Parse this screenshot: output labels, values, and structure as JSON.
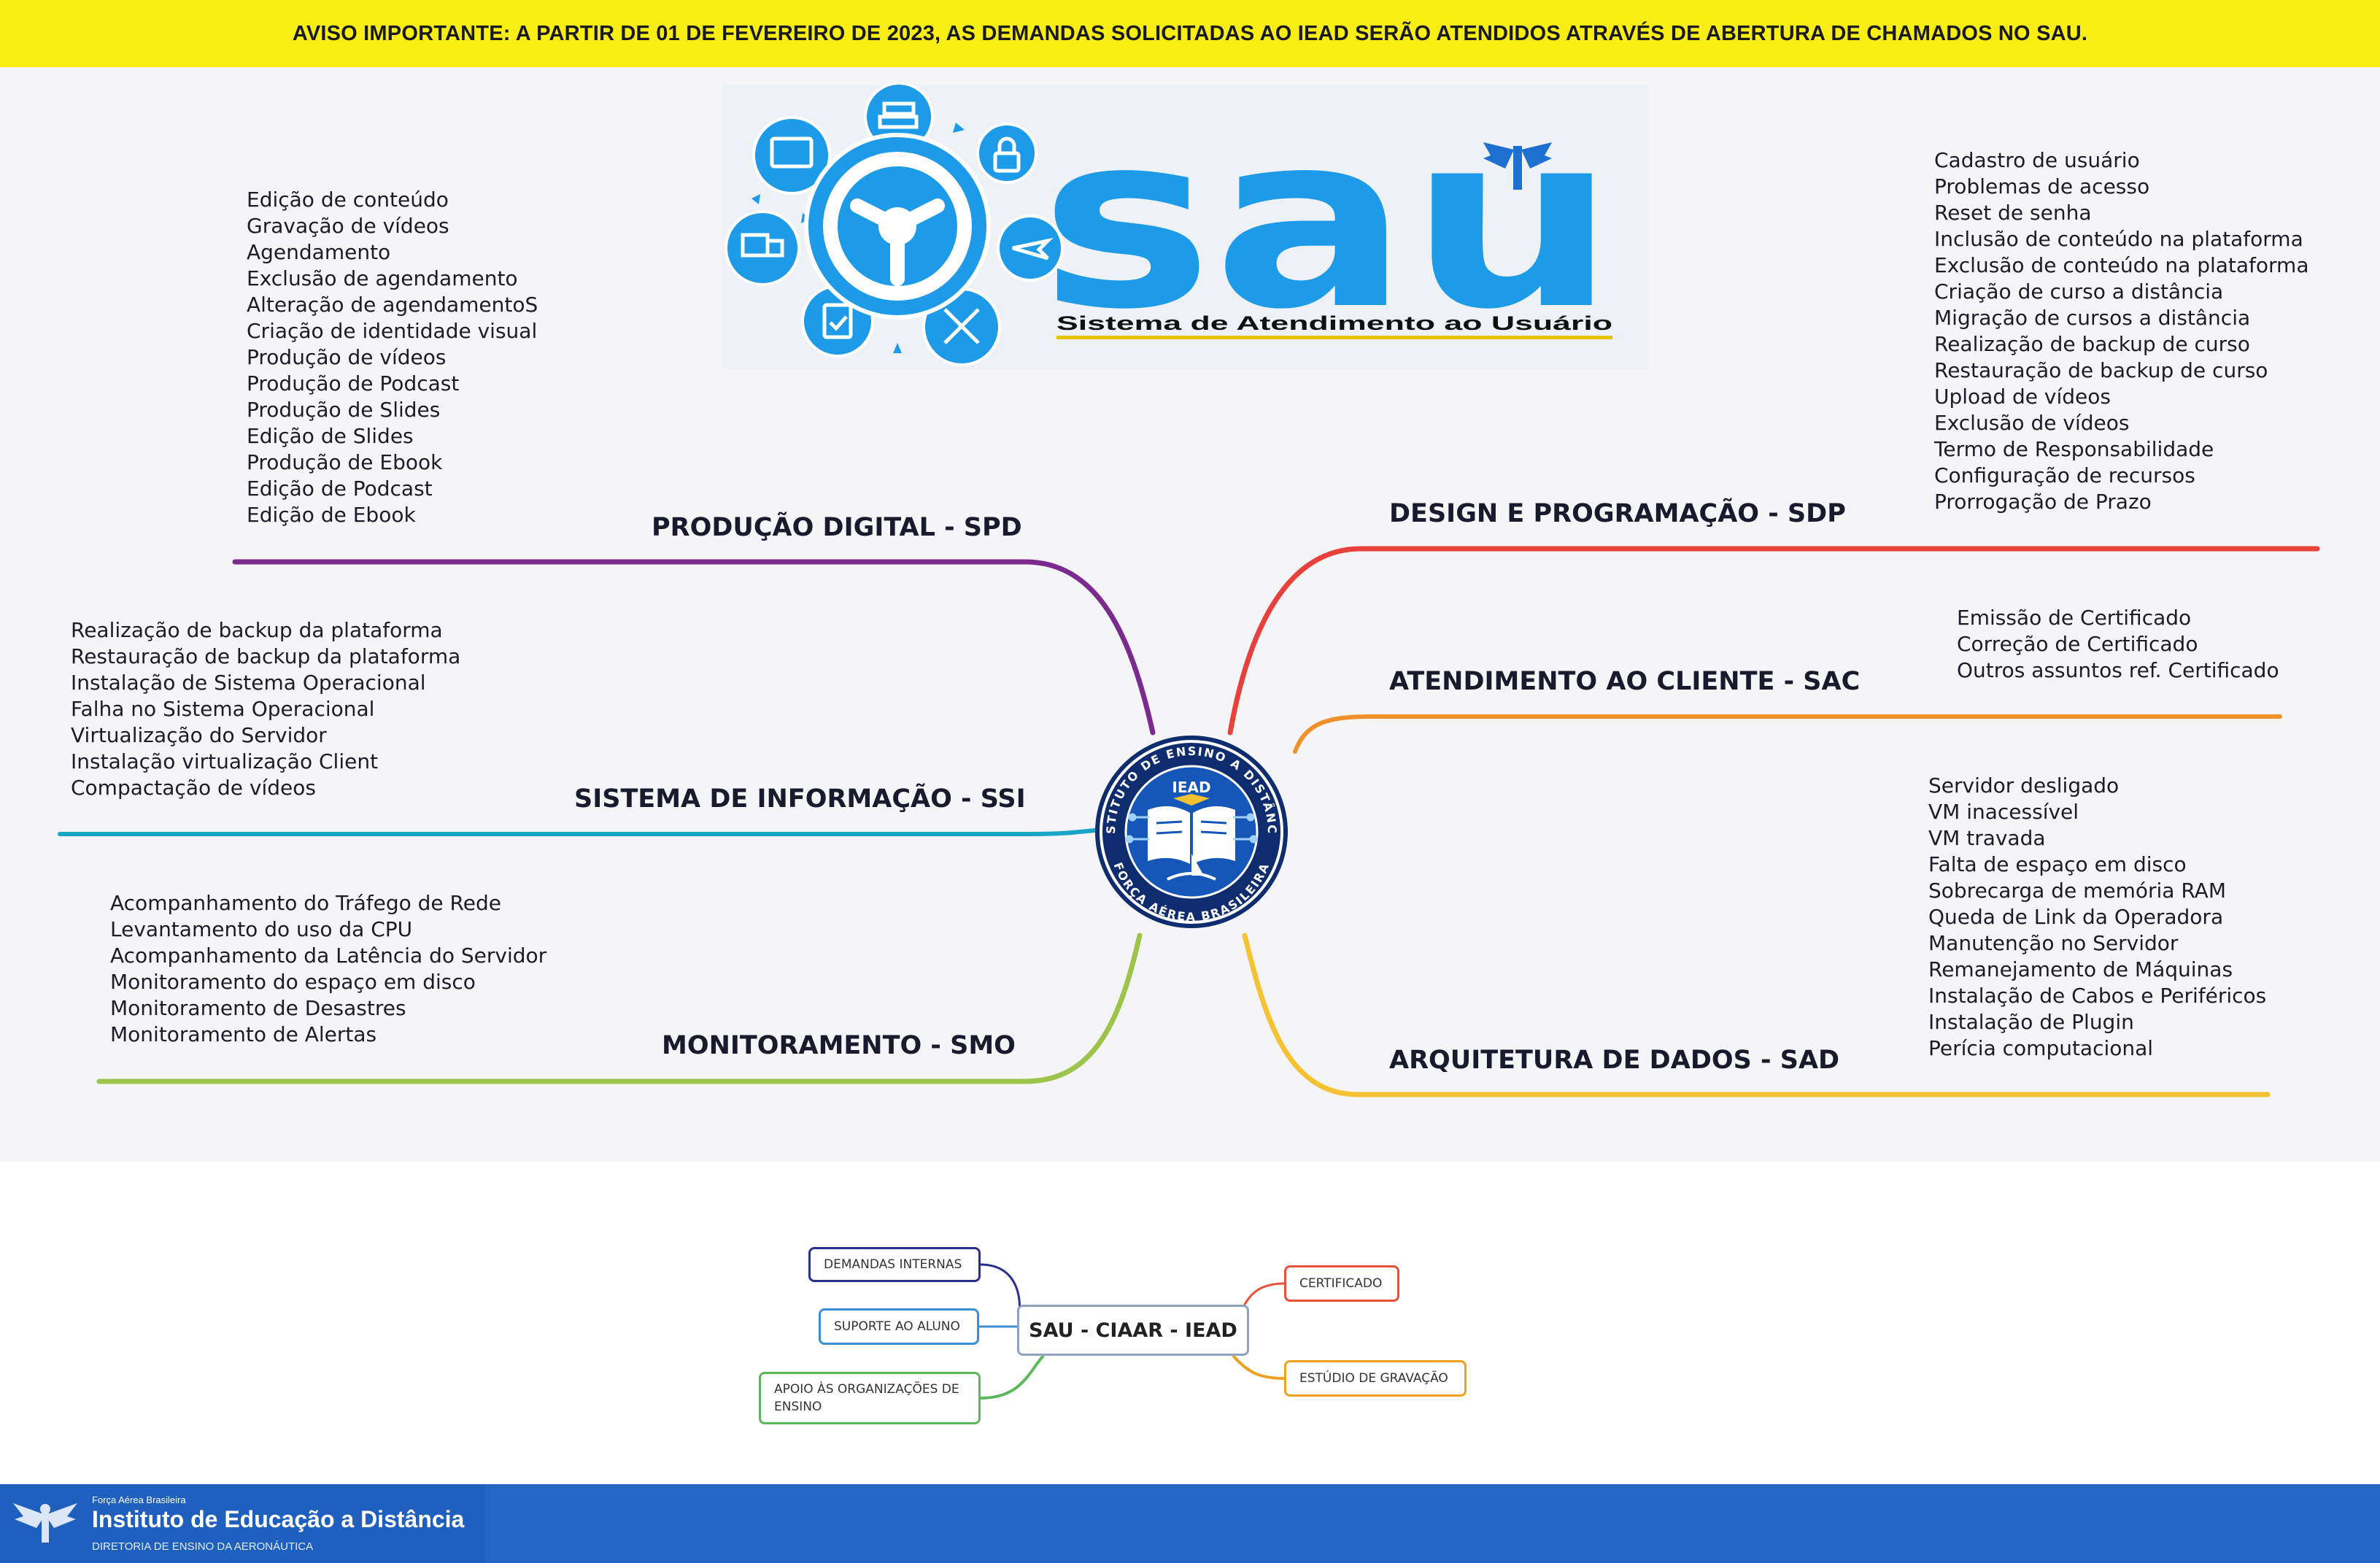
{
  "banner": {
    "text": "AVISO IMPORTANTE: A PARTIR DE 01 DE FEVEREIRO  DE 2023, AS DEMANDAS SOLICITADAS AO IEAD SERÃO ATENDIDOS ATRAVÉS DE ABERTURA DE CHAMADOS NO SAU."
  },
  "logo": {
    "word": "sau",
    "subtitle": "Sistema de Atendimento ao Usuário"
  },
  "emblem": {
    "top_text": "INSTITUTO DE ENSINO A DISTÂNCIA",
    "bottom_text": "FORÇA AÉREA BRASILEIRA",
    "center_text": "IEAD"
  },
  "branches": {
    "spd": {
      "title": "PRODUÇÃO DIGITAL - SPD",
      "color": "#7b2a8f",
      "items": [
        "Edição de conteúdo",
        "Gravação de vídeos",
        "Agendamento",
        "Exclusão de agendamento",
        "Alteração de agendamentoS",
        "Criação de identidade visual",
        "Produção de vídeos",
        "Produção de Podcast",
        "Produção de Slides",
        "Edição de Slides",
        "Produção de Ebook",
        "Edição de Podcast",
        "Edição de Ebook"
      ]
    },
    "ssi": {
      "title": "SISTEMA DE INFORMAÇÃO - SSI",
      "color": "#1aa4c8",
      "items": [
        "Realização de backup da plataforma",
        "Restauração de backup da plataforma",
        "Instalação de Sistema Operacional",
        "Falha no Sistema Operacional",
        "Virtualização do  Servidor",
        "Instalação virtualização Client",
        "Compactação de vídeos"
      ]
    },
    "smo": {
      "title": "MONITORAMENTO - SMO",
      "color": "#9cc34a",
      "items": [
        "Acompanhamento do Tráfego de Rede",
        "Levantamento do uso da CPU",
        "Acompanhamento da Latência do Servidor",
        "Monitoramento do espaço em disco",
        "Monitoramento de Desastres",
        "Monitoramento de Alertas"
      ]
    },
    "sdp": {
      "title": "DESIGN E PROGRAMAÇÃO - SDP",
      "color": "#e8403a",
      "items": [
        "Cadastro de usuário",
        "Problemas de acesso",
        "Reset de senha",
        "Inclusão de conteúdo na plataforma",
        "Exclusão de conteúdo na plataforma",
        "Criação de curso a distância",
        "Migração de cursos a distância",
        "Realização de backup de curso",
        "Restauração de backup de curso",
        "Upload de vídeos",
        "Exclusão de vídeos",
        "Termo de Responsabilidade",
        "Configuração de recursos",
        "Prorrogação de Prazo"
      ]
    },
    "sac": {
      "title": "ATENDIMENTO AO CLIENTE - SAC",
      "color": "#f0902a",
      "items": [
        "Emissão de Certificado",
        "Correção de Certificado",
        "Outros assuntos ref. Certificado"
      ]
    },
    "sad": {
      "title": "ARQUITETURA DE DADOS - SAD",
      "color": "#f5c232",
      "items": [
        "Servidor desligado",
        "VM inacessível",
        "VM travada",
        "Falta de espaço em disco",
        "Sobrecarga de memória RAM",
        "Queda de Link da Operadora",
        "Manutenção no Servidor",
        "Remanejamento de Máquinas",
        "Instalação de Cabos e Periféricos",
        "Instalação de Plugin",
        "Perícia computacional"
      ]
    }
  },
  "small_map": {
    "center": "SAU - CIAAR - IEAD",
    "left": [
      {
        "label": "DEMANDAS INTERNAS",
        "color": "#2b2f8f"
      },
      {
        "label": "SUPORTE AO ALUNO",
        "color": "#3a8fd6"
      },
      {
        "label": "APOIO ÀS ORGANIZAÇÕES DE ENSINO",
        "color": "#5cb85c"
      }
    ],
    "right": [
      {
        "label": "CERTIFICADO",
        "color": "#e8503a"
      },
      {
        "label": "ESTÚDIO DE GRAVAÇÃO",
        "color": "#f0a020"
      }
    ]
  },
  "footer": {
    "org_small": "Força Aérea Brasileira",
    "title": "Instituto de Educação a Distância",
    "subtitle": "DIRETORIA DE ENSINO DA AERONÁUTICA"
  }
}
